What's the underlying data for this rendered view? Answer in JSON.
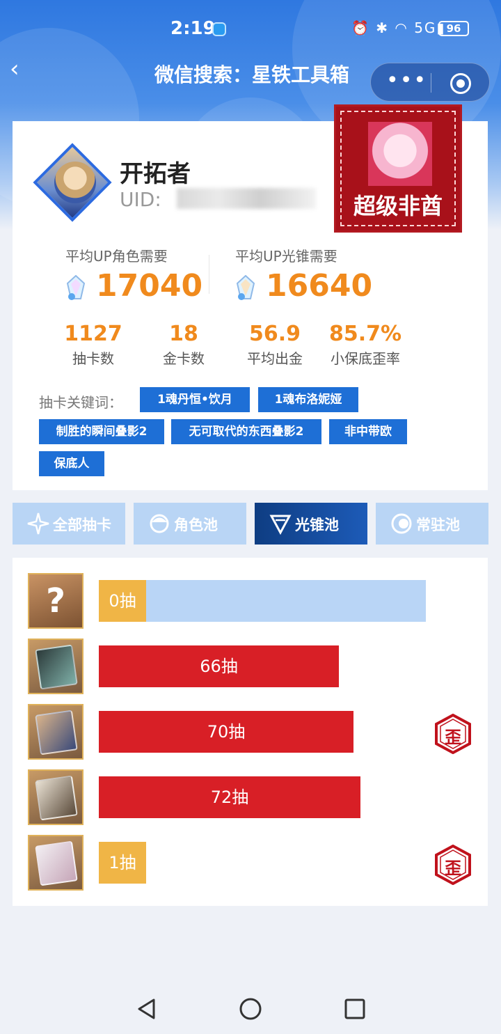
{
  "status_bar": {
    "time": "2:19",
    "network": "5G",
    "battery": "96"
  },
  "nav": {
    "back": "‹",
    "title": "微信搜索：星铁工具箱"
  },
  "profile": {
    "name": "开拓者",
    "uid_label": "UID: ",
    "badge_text": "超级非酋"
  },
  "averages": [
    {
      "label": "平均UP角色需要",
      "value": "17040"
    },
    {
      "label": "平均UP光锥需要",
      "value": "16640"
    }
  ],
  "stats": [
    {
      "value": "1127",
      "label": "抽卡数"
    },
    {
      "value": "18",
      "label": "金卡数"
    },
    {
      "value": "56.9",
      "label": "平均出金"
    },
    {
      "value": "85.7%",
      "label": "小保底歪率"
    }
  ],
  "keywords": {
    "label": "抽卡关键词：",
    "tags": [
      "1魂丹恒•饮月",
      "1魂布洛妮娅",
      "制胜的瞬间叠影2",
      "无可取代的东西叠影2",
      "非中带欧",
      "保底人"
    ]
  },
  "pool_tabs": [
    {
      "label": "全部抽卡",
      "icon": "sparkle-icon",
      "active": false
    },
    {
      "label": "角色池",
      "icon": "character-icon",
      "active": false
    },
    {
      "label": "光锥池",
      "icon": "light-cone-icon",
      "active": true
    },
    {
      "label": "常驻池",
      "icon": "standard-pool-icon",
      "active": false
    }
  ],
  "pull_records": [
    {
      "label": "0抽",
      "pulls": 0,
      "fraction": 0.145,
      "kind": "pending",
      "lost_5050": false,
      "thumb": "unknown"
    },
    {
      "label": "66抽",
      "pulls": 66,
      "kind": "gold",
      "lost_5050": false,
      "thumb": "light-cone"
    },
    {
      "label": "70抽",
      "pulls": 70,
      "kind": "gold",
      "lost_5050": true,
      "thumb": "light-cone"
    },
    {
      "label": "72抽",
      "pulls": 72,
      "kind": "gold",
      "lost_5050": false,
      "thumb": "light-cone"
    },
    {
      "label": "1抽",
      "pulls": 1,
      "fraction": 0.145,
      "kind": "lucky",
      "lost_5050": true,
      "thumb": "light-cone"
    }
  ],
  "lost_badge_text": "歪",
  "colors": {
    "accent": "#f08a1d",
    "primary": "#1e6fd6",
    "bar_red": "#d81f26",
    "bar_gold": "#f0b546",
    "bar_track": "#b9d5f6"
  }
}
